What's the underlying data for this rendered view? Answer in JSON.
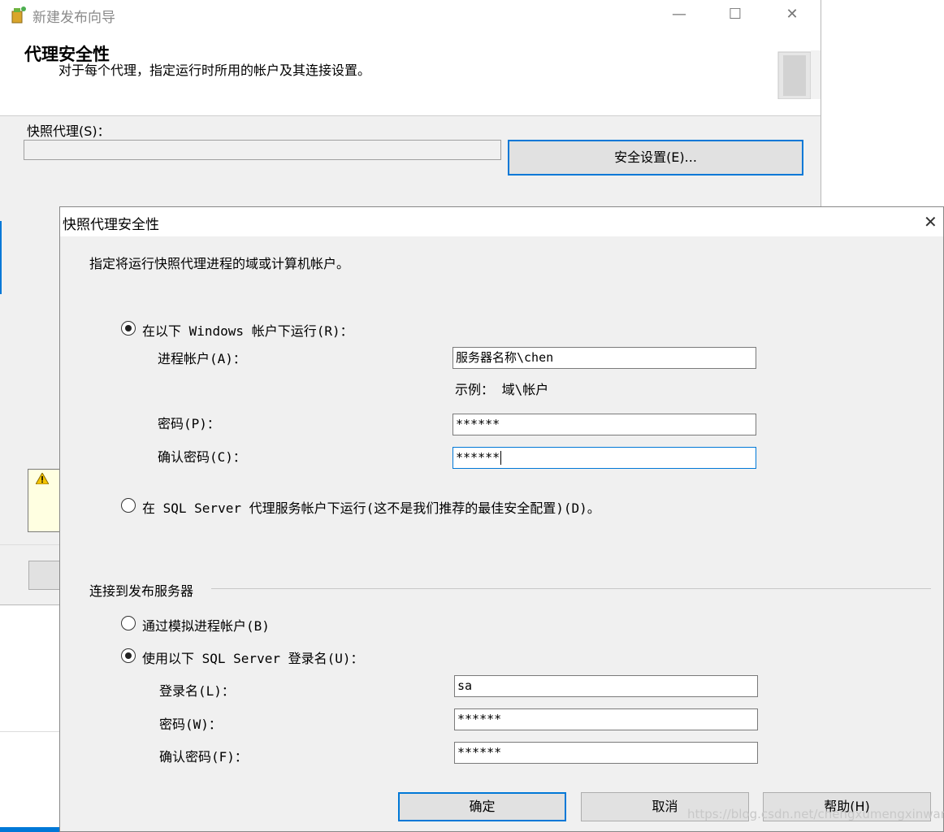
{
  "wizard": {
    "title": "新建发布向导",
    "header_title": "代理安全性",
    "header_subtitle": "对于每个代理，指定运行时所用的帐户及其连接设置。",
    "snapshot_agent_label": "快照代理(S)：",
    "security_button": "安全设置(E)...",
    "window_controls": {
      "minimize": "—",
      "maximize": "☐",
      "close": "✕"
    }
  },
  "dialog": {
    "title": "快照代理安全性",
    "close": "✕",
    "instruction": "指定将运行快照代理进程的域或计算机帐户。",
    "run_under_windows": {
      "label": "在以下 Windows 帐户下运行(R)：",
      "checked": true
    },
    "process_account": {
      "label": "进程帐户(A)：",
      "value": "服务器名称\\chen",
      "example": "示例： 域\\帐户"
    },
    "password": {
      "label": "密码(P)：",
      "value": "******"
    },
    "confirm_password": {
      "label": "确认密码(C)：",
      "value": "******"
    },
    "run_under_sql_agent": {
      "label": "在 SQL Server 代理服务帐户下运行(这不是我们推荐的最佳安全配置)(D)。",
      "checked": false
    },
    "connect_group_title": "连接到发布服务器",
    "impersonate": {
      "label": "通过模拟进程帐户(B)",
      "checked": false
    },
    "use_sql_login": {
      "label": "使用以下 SQL Server 登录名(U)：",
      "checked": true
    },
    "login": {
      "label": "登录名(L)：",
      "value": "sa"
    },
    "login_password": {
      "label": "密码(W)：",
      "value": "******"
    },
    "login_confirm": {
      "label": "确认密码(F)：",
      "value": "******"
    },
    "buttons": {
      "ok": "确定",
      "cancel": "取消",
      "help": "帮助(H)"
    },
    "watermark": "https://blog.csdn.net/chengxumengxinwang"
  }
}
